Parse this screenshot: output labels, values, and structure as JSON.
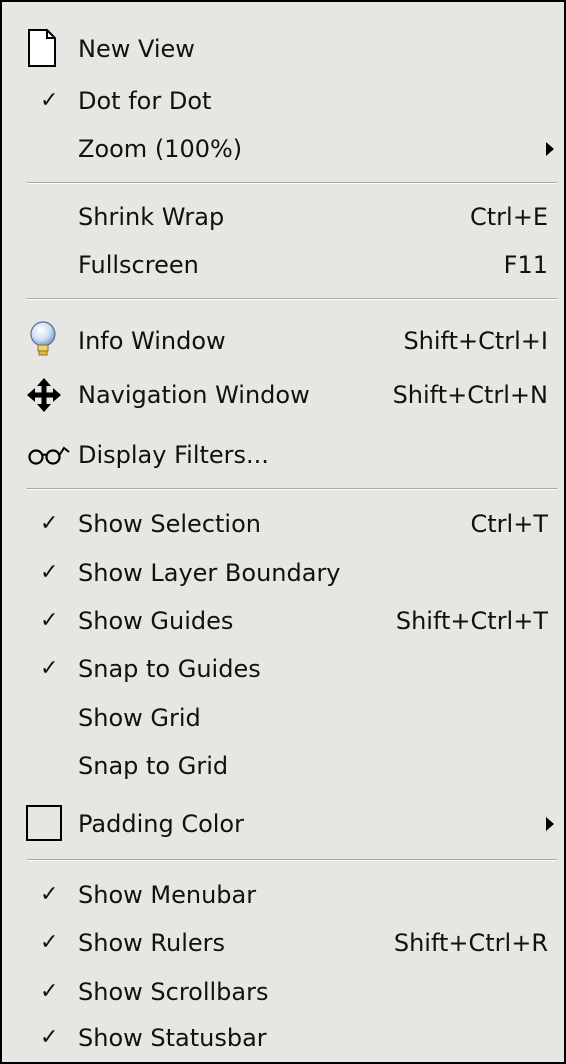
{
  "menu": {
    "new_view": "New View",
    "dot_for_dot": "Dot for Dot",
    "zoom": "Zoom (100%)",
    "shrink_wrap": "Shrink Wrap",
    "shrink_wrap_accel": "Ctrl+E",
    "fullscreen": "Fullscreen",
    "fullscreen_accel": "F11",
    "info_window": "Info Window",
    "info_window_accel": "Shift+Ctrl+I",
    "navigation_window": "Navigation Window",
    "navigation_window_accel": "Shift+Ctrl+N",
    "display_filters": "Display Filters...",
    "show_selection": "Show Selection",
    "show_selection_accel": "Ctrl+T",
    "show_layer_boundary": "Show Layer Boundary",
    "show_guides": "Show Guides",
    "show_guides_accel": "Shift+Ctrl+T",
    "snap_to_guides": "Snap to Guides",
    "show_grid": "Show Grid",
    "snap_to_grid": "Snap to Grid",
    "padding_color": "Padding Color",
    "show_menubar": "Show Menubar",
    "show_rulers": "Show Rulers",
    "show_rulers_accel": "Shift+Ctrl+R",
    "show_scrollbars": "Show Scrollbars",
    "show_statusbar": "Show Statusbar",
    "check_mark": "✓"
  },
  "states": {
    "dot_for_dot": true,
    "show_selection": true,
    "show_layer_boundary": true,
    "show_guides": true,
    "snap_to_guides": true,
    "show_grid": false,
    "snap_to_grid": false,
    "show_menubar": true,
    "show_rulers": true,
    "show_scrollbars": true,
    "show_statusbar": true
  },
  "icons": {
    "new_view": "document-icon",
    "info_window": "lightbulb-icon",
    "navigation_window": "move-arrows-icon",
    "display_filters": "glasses-icon",
    "padding_color": "color-swatch-icon",
    "submenu": "submenu-arrow-icon",
    "checked": "check-icon"
  },
  "colors": {
    "menu_background": "#e6e6e2",
    "border": "#000000",
    "separator": "#a8a8a4",
    "text": "#111111",
    "padding_color_swatch": "#e6e6e2"
  }
}
